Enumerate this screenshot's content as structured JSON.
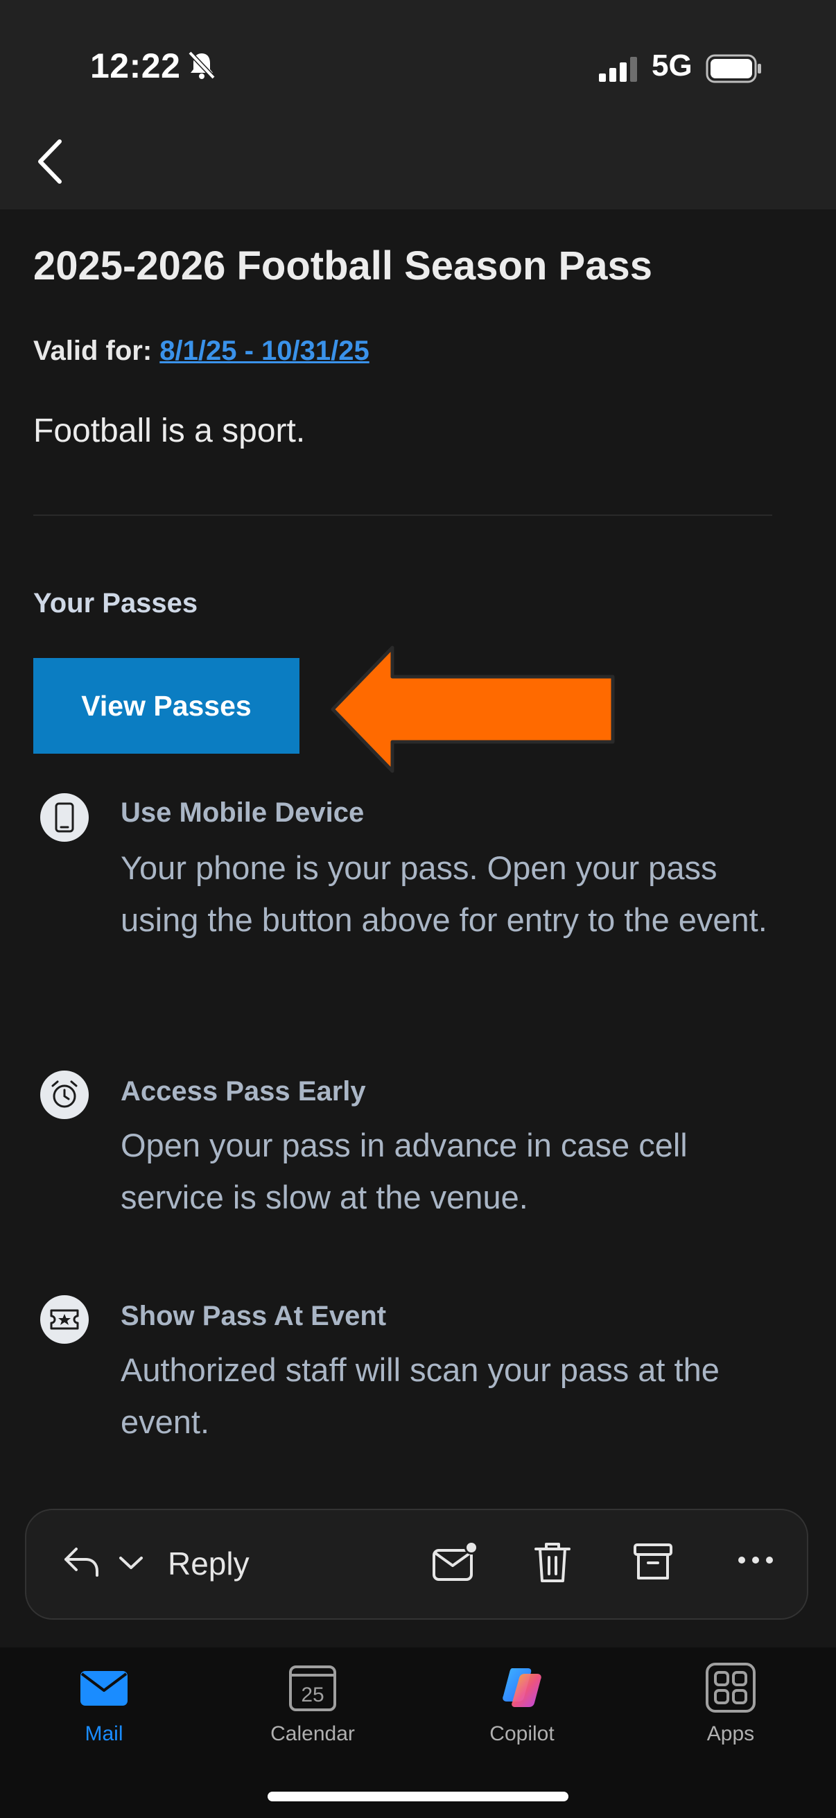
{
  "status_bar": {
    "time": "12:22",
    "network": "5G"
  },
  "email": {
    "title": "2025-2026 Football Season Pass",
    "valid_label": "Valid for:",
    "valid_dates": "8/1/25 - 10/31/25",
    "description": "Football is a sport.",
    "section_title": "Your Passes",
    "view_button": "View Passes",
    "items": [
      {
        "icon": "phone-icon",
        "heading": "Use Mobile Device",
        "body": "Your phone is your pass. Open your pass using the button above for entry to the event."
      },
      {
        "icon": "alarm-clock-icon",
        "heading": "Access Pass Early",
        "body": "Open your pass in advance in case cell service is slow at the venue."
      },
      {
        "icon": "ticket-icon",
        "heading": "Show Pass At Event",
        "body": "Authorized staff will scan your pass at the event."
      }
    ]
  },
  "reply_bar": {
    "reply_label": "Reply"
  },
  "tabs": [
    {
      "label": "Mail",
      "icon": "mail-icon",
      "active": true
    },
    {
      "label": "Calendar",
      "icon": "calendar-icon",
      "date": "25",
      "active": false
    },
    {
      "label": "Copilot",
      "icon": "copilot-icon",
      "active": false
    },
    {
      "label": "Apps",
      "icon": "apps-grid-icon",
      "active": false
    }
  ],
  "colors": {
    "accent": "#0b7dc2",
    "link": "#3a92ea",
    "arrow": "#ff6a00",
    "active_tab": "#1a8cff"
  }
}
